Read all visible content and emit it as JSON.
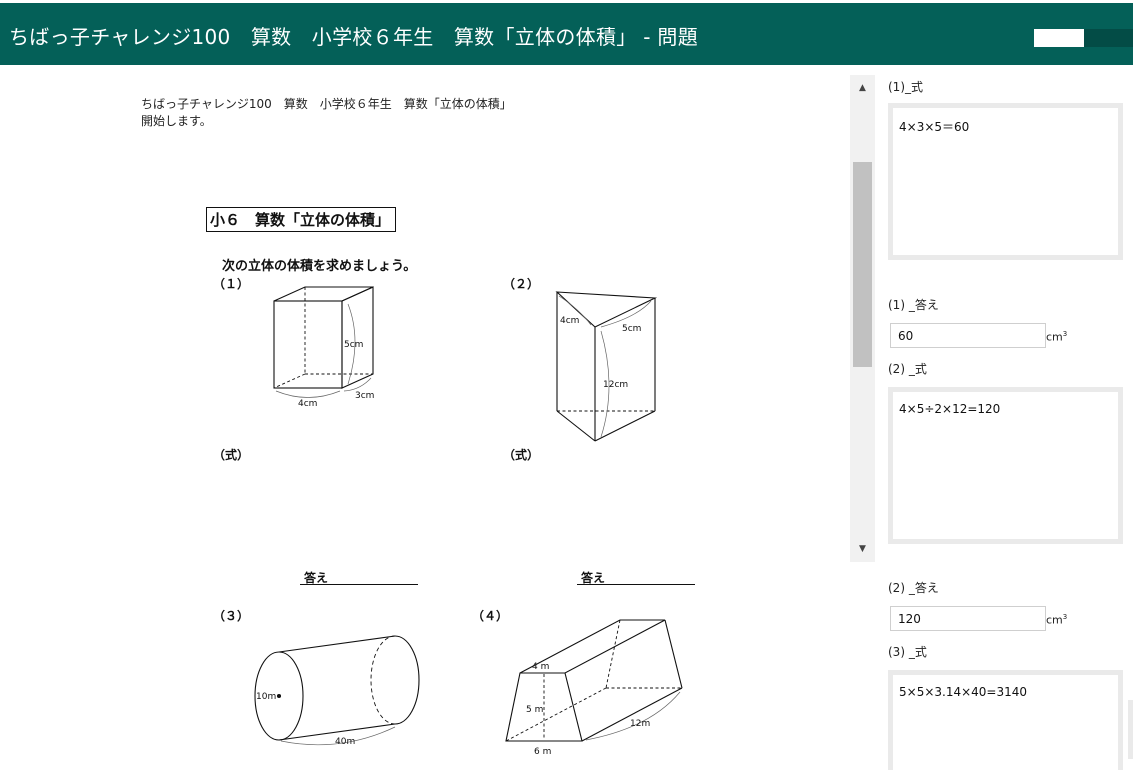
{
  "header": {
    "title": "ちばっ子チャレンジ100　算数　小学校６年生　算数「立体の体積」 - 問題"
  },
  "document": {
    "intro_line1": "ちばっ子チャレンジ100　算数　小学校６年生　算数「立体の体積」",
    "intro_line2": "開始します。",
    "box_title": "小６　算数「立体の体積」",
    "instruction": "次の立体の体積を求めましょう。",
    "q1_label": "（１）",
    "q2_label": "（２）",
    "q3_label": "（３）",
    "q4_label": "（４）",
    "shiki_label": "（式）",
    "kotae_label": "答え",
    "fig1": {
      "height": "5cm",
      "width": "4cm",
      "depth": "3cm"
    },
    "fig2": {
      "side_a": "4cm",
      "side_b": "5cm",
      "length": "12cm"
    },
    "fig3": {
      "diameter": "10m",
      "length": "40m"
    },
    "fig4": {
      "top": "4 m",
      "height": "5 m",
      "bottom": "6 m",
      "length": "12m"
    }
  },
  "scrollbar": {
    "up": "▲",
    "down": "▼"
  },
  "answers": {
    "q1_shiki_label": "(1)_式",
    "q1_shiki_value": "4×3×5＝60",
    "q1_kotae_label": "(1) _答え",
    "q1_kotae_value": "60",
    "q2_shiki_label": "(2) _式",
    "q2_shiki_value": "4×5÷2×12=120",
    "q2_kotae_label": "(2) _答え",
    "q2_kotae_value": "120",
    "q3_shiki_label": "(3) _式",
    "q3_shiki_value": "5×5×3.14×40=3140",
    "unit": "cm",
    "unit_exp": "3"
  }
}
